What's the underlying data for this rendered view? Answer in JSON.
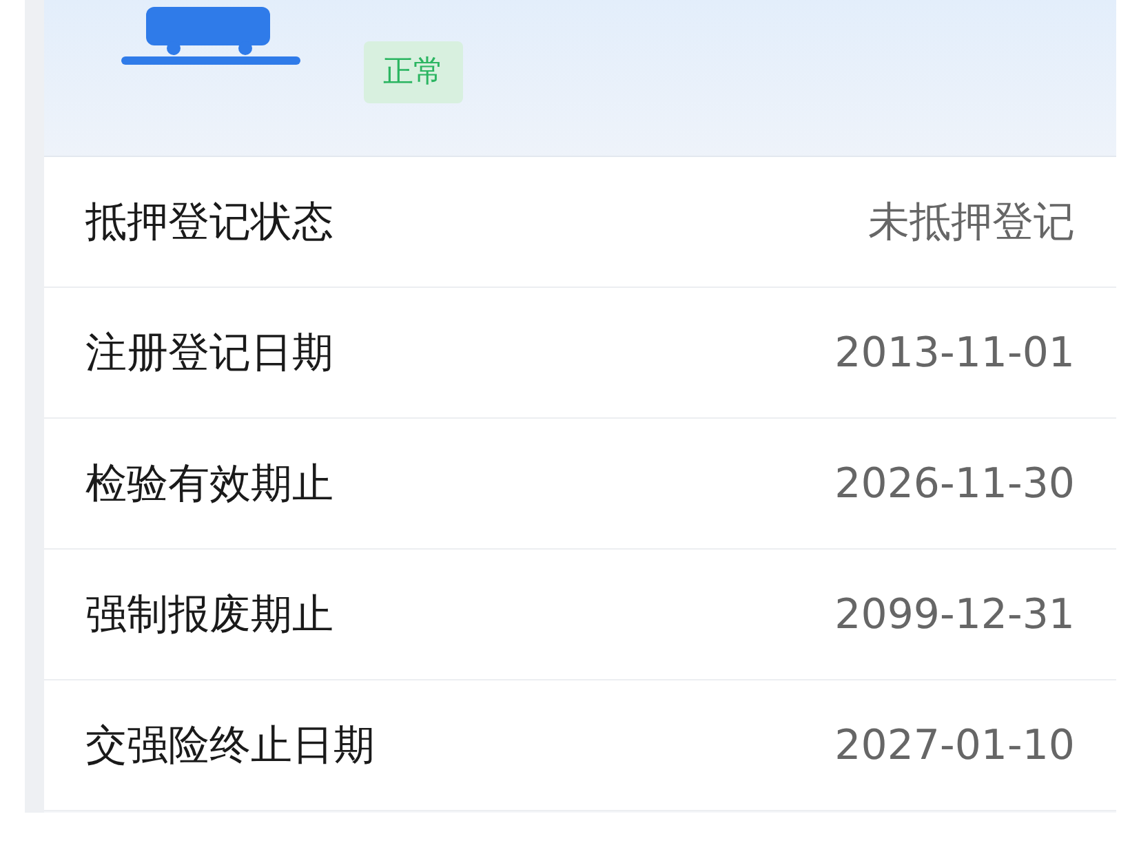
{
  "vehicle": {
    "status_badge": "正常"
  },
  "rows": [
    {
      "label": "抵押登记状态",
      "value": "未抵押登记"
    },
    {
      "label": "注册登记日期",
      "value": "2013-11-01"
    },
    {
      "label": "检验有效期止",
      "value": "2026-11-30"
    },
    {
      "label": "强制报废期止",
      "value": "2099-12-31"
    },
    {
      "label": "交强险终止日期",
      "value": "2027-01-10"
    }
  ]
}
